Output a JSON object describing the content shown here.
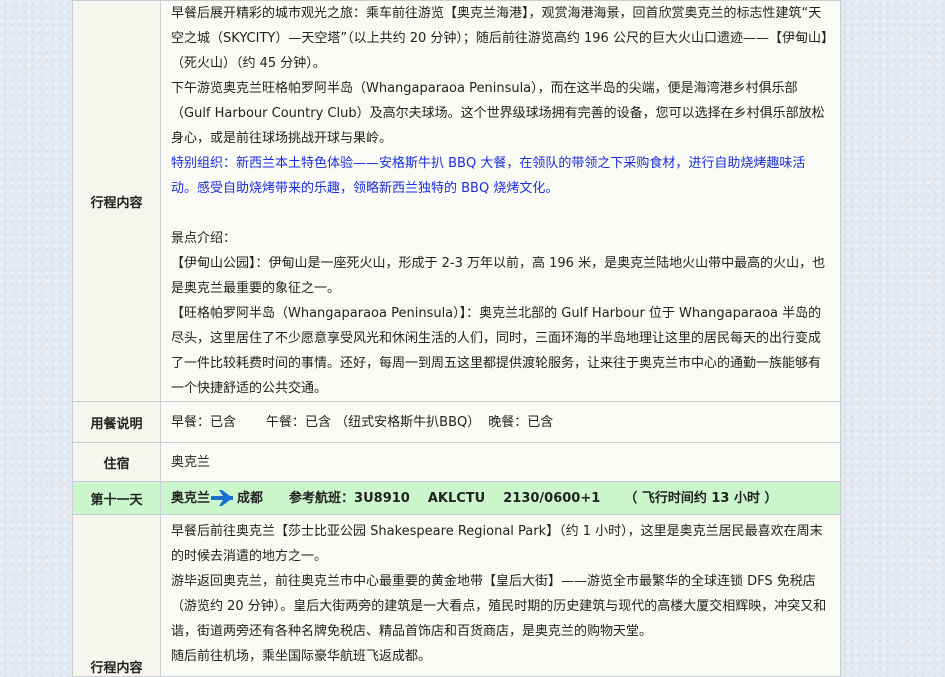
{
  "row1": {
    "label": "行程内容",
    "paragraphs": [
      "早餐后展开精彩的城市观光之旅：乘车前往游览【奥克兰海港】，观赏海港海景，回首欣赏奥克兰的标志性建筑“天空之城（SKYCITY）—天空塔”（以上共约 20 分钟）；随后前往游览高约 196 公尺的巨大火山口遗迹——【伊甸山】（死火山）（约 45 分钟）。",
      "下午游览奥克兰旺格帕罗阿半岛（Whangaparaoa Peninsula），而在这半岛的尖端，便是海湾港乡村俱乐部（Gulf Harbour Country Club）及高尔夫球场。这个世界级球场拥有完善的设备，您可以选择在乡村俱乐部放松身心，或是前往球场挑战开球与果岭。"
    ],
    "special": "特别组织：新西兰本土特色体验——安格斯牛扒 BBQ 大餐，在领队的带领之下采购食材，进行自助烧烤趣味活动。感受自助烧烤带来的乐趣，领略新西兰独特的 BBQ 烧烤文化。",
    "intro_heading": "景点介绍：",
    "intro_paragraphs": [
      "【伊甸山公园】：伊甸山是一座死火山，形成于 2-3 万年以前，高 196 米，是奥克兰陆地火山带中最高的火山，也是奥克兰最重要的象征之一。",
      "【旺格帕罗阿半岛（Whangaparaoa Peninsula）】：奥克兰北部的 Gulf Harbour 位于 Whangaparaoa 半岛的尽头，这里居住了不少愿意享受风光和休闲生活的人们，同时，三面环海的半岛地理让这里的居民每天的出行变成了一件比较耗费时间的事情。还好，每周一到周五这里都提供渡轮服务，让来往于奥克兰市中心的通勤一族能够有一个快捷舒适的公共交通。"
    ]
  },
  "meals": {
    "label": "用餐说明",
    "breakfast": "早餐：已含",
    "lunch": "午餐：已含 （纽式安格斯牛扒BBQ）",
    "dinner": "晚餐：已含"
  },
  "lodging": {
    "label": "住宿",
    "value": "奥克兰"
  },
  "day11": {
    "label": "第十一天",
    "from": "奥克兰",
    "to": "成都",
    "flight_label": "参考航班：",
    "flight": "3U8910",
    "route": "AKLCTU",
    "times": "2130/0600+1",
    "duration": "（ 飞行时间约 13 小时 ）",
    "arrow_color": "#1a6fd1"
  },
  "row2": {
    "label": "行程内容",
    "paragraphs": [
      "早餐后前往奥克兰【莎士比亚公园 Shakespeare Regional Park】（约 1 小时），这里是奥克兰居民最喜欢在周末的时候去消遣的地方之一。",
      "游毕返回奥克兰，前往奥克兰市中心最重要的黄金地带【皇后大街】——游览全市最繁华的全球连锁 DFS 免税店（游览约 20 分钟）。皇后大街两旁的建筑是一大看点，殖民时期的历史建筑与现代的高楼大厦交相辉映，冲突又和谐，街道两旁还有各种名牌免税店、精品首饰店和百货商店，是奥克兰的购物天堂。",
      "随后前往机场，乘坐国际豪华航班飞返成都。"
    ]
  }
}
